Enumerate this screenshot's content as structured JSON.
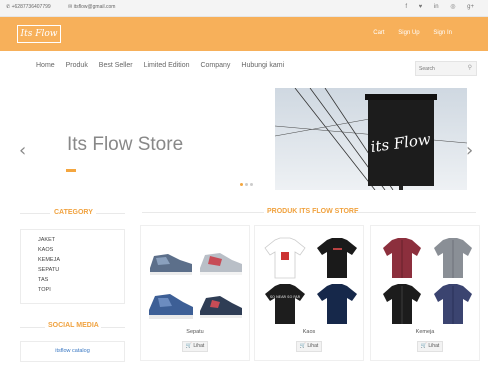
{
  "topbar": {
    "phone": "+6287736407799",
    "email": "itsflow@gmail.com",
    "social_icons": [
      "facebook-icon",
      "twitter-icon",
      "linkedin-icon",
      "instagram-icon",
      "google-plus-icon"
    ],
    "social_glyphs": [
      "f",
      "♥",
      "in",
      "◎",
      "g+"
    ]
  },
  "brandbar": {
    "logo_text": "Its Flow",
    "nav": [
      "Cart",
      "Sign Up",
      "Sign In"
    ]
  },
  "mainnav": {
    "items": [
      "Home",
      "Produk",
      "Best Seller",
      "Limited Edition",
      "Company",
      "Hubungi kami"
    ],
    "search_placeholder": "Search"
  },
  "slider": {
    "title": "Its Flow Store",
    "photo_sign_text": "its Flow",
    "dots": 3,
    "active_dot": 0
  },
  "sidebar": {
    "category_title": "CATEGORY",
    "categories": [
      "JAKET",
      "KAOS",
      "KEMEJA",
      "SEPATU",
      "TAS",
      "TOPI"
    ],
    "social_title": "SOCIAL MEDIA",
    "social_link": "itsflow catalog"
  },
  "products": {
    "title": "PRODUK ITS FLOW STORE",
    "button_label": "Lihat",
    "cards": [
      {
        "name": "Sepatu"
      },
      {
        "name": "Kaos",
        "tee_print": "SO NEAR SO FAR"
      },
      {
        "name": "Kemeja"
      }
    ]
  },
  "colors": {
    "brand_orange": "#f7b05a",
    "accent": "#f0a23f",
    "link": "#3a78c3"
  }
}
